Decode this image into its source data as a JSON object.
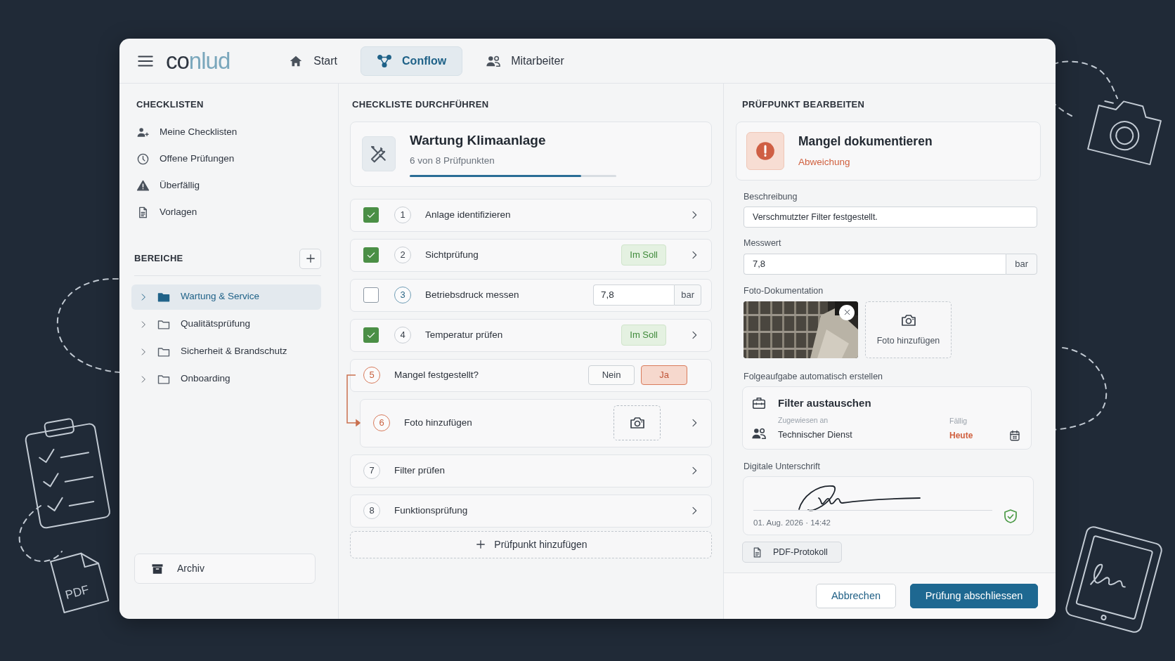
{
  "header": {
    "logo": [
      "co",
      "nlud"
    ],
    "nav": [
      {
        "label": "Start",
        "selected": false
      },
      {
        "label": "Conflow",
        "selected": true
      },
      {
        "label": "Mitarbeiter",
        "selected": false
      }
    ]
  },
  "sidebar": {
    "title": "CHECKLISTEN",
    "items": [
      {
        "label": "Meine Checklisten"
      },
      {
        "label": "Offene Prüfungen"
      },
      {
        "label": "Überfällig"
      },
      {
        "label": "Vorlagen"
      }
    ],
    "areas_title": "BEREICHE",
    "areas": [
      {
        "label": "Wartung & Service",
        "selected": true
      },
      {
        "label": "Qualitätsprüfung",
        "selected": false
      },
      {
        "label": "Sicherheit & Brandschutz",
        "selected": false
      },
      {
        "label": "Onboarding",
        "selected": false
      }
    ],
    "archive": "Archiv"
  },
  "checklist": {
    "title": "CHECKLISTE DURCHFÜHREN",
    "name": "Wartung Klimaanlage",
    "progress_text": "6 von 8 Prüfpunkten",
    "level": 0.83,
    "items": [
      {
        "kind": "check",
        "number": "1",
        "label": "Anlage identifizieren",
        "checked": true,
        "current": false,
        "flagged": false
      },
      {
        "kind": "check",
        "number": "2",
        "label": "Sichtprüfung",
        "checked": true,
        "current": false,
        "flagged": false,
        "badge": "Im Soll"
      },
      {
        "kind": "measure",
        "number": "3",
        "label": "Betriebsdruck messen",
        "checked": false,
        "current": true,
        "flagged": false,
        "value": "7,8",
        "unit": "bar"
      },
      {
        "kind": "check",
        "number": "4",
        "label": "Temperatur prüfen",
        "checked": true,
        "current": false,
        "flagged": false,
        "badge": "Im Soll"
      },
      {
        "kind": "choice",
        "number": "5",
        "label": "Mangel festgestellt?",
        "current": false,
        "flagged": true,
        "options": [
          {
            "label": "Nein",
            "selected": false
          },
          {
            "label": "Ja",
            "selected": true
          }
        ],
        "children": [
          {
            "number": "6",
            "label": "Foto hinzufügen",
            "current": false,
            "flagged": true
          }
        ]
      },
      {
        "kind": "plain",
        "number": "7",
        "label": "Filter prüfen",
        "current": false,
        "flagged": false
      },
      {
        "kind": "plain",
        "number": "8",
        "label": "Funktionsprüfung",
        "current": false,
        "flagged": false
      }
    ],
    "add_label": "Prüfpunkt hinzufügen"
  },
  "editor": {
    "title": "PRÜFPUNKT BEARBEITEN",
    "issue": {
      "title": "Mangel dokumentieren",
      "subtitle": "Abweichung"
    },
    "description": {
      "label": "Beschreibung",
      "value": "Verschmutzter Filter festgestellt."
    },
    "measurement": {
      "label": "Messwert",
      "value": "7,8",
      "unit": "bar"
    },
    "photos": {
      "label": "Foto-Dokumentation",
      "add_label": "Foto hinzufügen"
    },
    "follow_up": {
      "label": "Folgeaufgabe automatisch erstellen",
      "title": "Filter austauschen",
      "assignee_label": "Zugewiesen an",
      "assignee": "Technischer Dienst",
      "due_label": "Fällig",
      "due": "Heute"
    },
    "signature": {
      "label": "Digitale Unterschrift",
      "timestamp": "01. Aug. 2026 · 14:42",
      "verified": true
    },
    "pdf_button": "PDF-Protokoll",
    "buttons": [
      {
        "label": "Abbrechen",
        "kind": "secondary"
      },
      {
        "label": "Prüfung abschliessen",
        "kind": "primary"
      }
    ]
  },
  "decor": {
    "document_label": "PDF"
  }
}
